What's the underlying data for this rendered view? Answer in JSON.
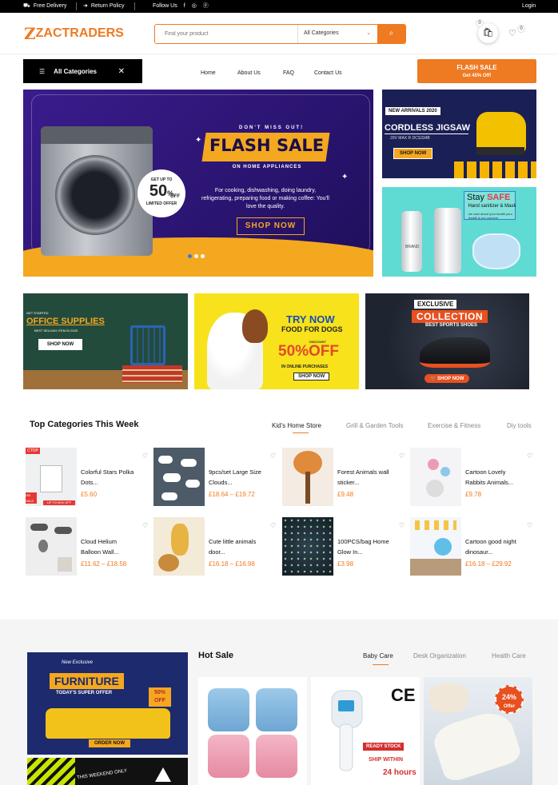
{
  "topbar": {
    "free_delivery": "Free Delivery",
    "return_policy": "Return Policy",
    "follow_us": "Follow Us",
    "login": "Login"
  },
  "header": {
    "logo_text": "ZACTRADERS",
    "search_placeholder": "Find your product",
    "category_select": "All Categories",
    "cart_count": "0",
    "wishlist_count": "0"
  },
  "nav": {
    "all_categories": "All Categories",
    "links": [
      "Home",
      "About Us",
      "FAQ",
      "Contact Us"
    ],
    "flash_sale_title": "FLASH SALE",
    "flash_sale_sub": "Get 45% Off!"
  },
  "hero": {
    "tagline": "DON'T MISS OUT!",
    "title": "FLASH SALE",
    "subtitle": "ON HOME APPLIANCES",
    "description": "For cooking, dishwashing, doing laundry, refrigerating, preparing food or making coffee: You'll love the quality.",
    "cta": "SHOP NOW",
    "offer_top": "GET UP TO",
    "offer_value": "50",
    "offer_pct": "%",
    "offer_off": "OFF",
    "offer_bottom": "LIMITED OFFER"
  },
  "banner_jigsaw": {
    "badge": "NEW ARRIVALS 2020",
    "title": "CORDLESS JIGSAW",
    "sub": "20V MAX R DCS334B",
    "cta": "SHOP NOW"
  },
  "banner_safe": {
    "title_a": "Stay",
    "title_b": "SAFE",
    "sub": "Hand sanitizer & Mask",
    "note": "we care about your health your health is our concern",
    "bottle_label": "BRAND"
  },
  "promos": {
    "office": {
      "small": "GET STARTED",
      "title": "OFFICE SUPPLIES",
      "sub": "BEST SELLING ITEM IN 2020",
      "cta": "SHOP NOW"
    },
    "dogs": {
      "t1": "TRY NOW",
      "t2": "FOOD FOR DOGS",
      "t3": "DISCOUNT",
      "t4": "50%OFF",
      "t5": "IN ONLINE PURCHASES",
      "cta": "SHOP NOW"
    },
    "shoes": {
      "t1": "EXCLUSIVE",
      "t2": "COLLECTION",
      "t3": "BEST SPORTS SHOES",
      "cta": "SHOP NOW"
    }
  },
  "top_categories": {
    "title": "Top Categories This Week",
    "tabs": [
      "Kid's Home Store",
      "Grill & Garden Tools",
      "Exercise & Fitness",
      "Diy tools"
    ],
    "products": [
      {
        "name_l1": "Colorful Stars Polka",
        "name_l2": "Dots...",
        "price": "£5.60"
      },
      {
        "name_l1": "9pcs/set Large Size",
        "name_l2": "Clouds...",
        "price": "£18.64 – £19.72"
      },
      {
        "name_l1": "Forest Animals wall",
        "name_l2": "sticker...",
        "price": "£9.48"
      },
      {
        "name_l1": "Cartoon Lovely",
        "name_l2": "Rabbits Animals...",
        "price": "£9.78"
      },
      {
        "name_l1": "Cloud Helium",
        "name_l2": "Balloon Wall...",
        "price": "£11.62 – £18.58"
      },
      {
        "name_l1": "Cute little animals",
        "name_l2": "door...",
        "price": "£16.18 – £16.98"
      },
      {
        "name_l1": "100PCS/bag Home",
        "name_l2": "Glow In...",
        "price": "£3.98"
      },
      {
        "name_l1": "Cartoon good night",
        "name_l2": "dinosaur...",
        "price": "£16.18 – £29.92"
      }
    ],
    "ribbon_top": "CTOP",
    "ribbon_sale": "ON SALE",
    "ribbon_upto": "UP TO 50% OFF"
  },
  "furniture_banner": {
    "tag": "New Exclusive",
    "title": "FURNITURE",
    "sub": "TODAY'S SUPER OFFER",
    "off_a": "50%",
    "off_b": "OFF",
    "cta": "ORDER NOW"
  },
  "weekend_banner": {
    "text": "THIS WEEKEND ONLY"
  },
  "hot_sale": {
    "title": "Hot Sale",
    "tabs": [
      "Baby Care",
      "Desk Organization",
      "Health Care"
    ],
    "ce": "CE",
    "ready": "READY STOCK",
    "ship": "SHIP WITHIN",
    "hours": "24 hours",
    "offer_pct": "24%",
    "offer_word": "Offer"
  },
  "colors": {
    "accent": "#ee7a22",
    "topbar": "#000000",
    "hero_bg": "#2a1470",
    "hero_gold": "#f4a81f"
  },
  "icons": [
    "truck-icon",
    "return-arrow-icon",
    "facebook-icon",
    "instagram-icon",
    "pinterest-icon",
    "search-icon",
    "cart-icon",
    "heart-icon",
    "menu-icon",
    "close-icon",
    "chevron-down-icon"
  ]
}
